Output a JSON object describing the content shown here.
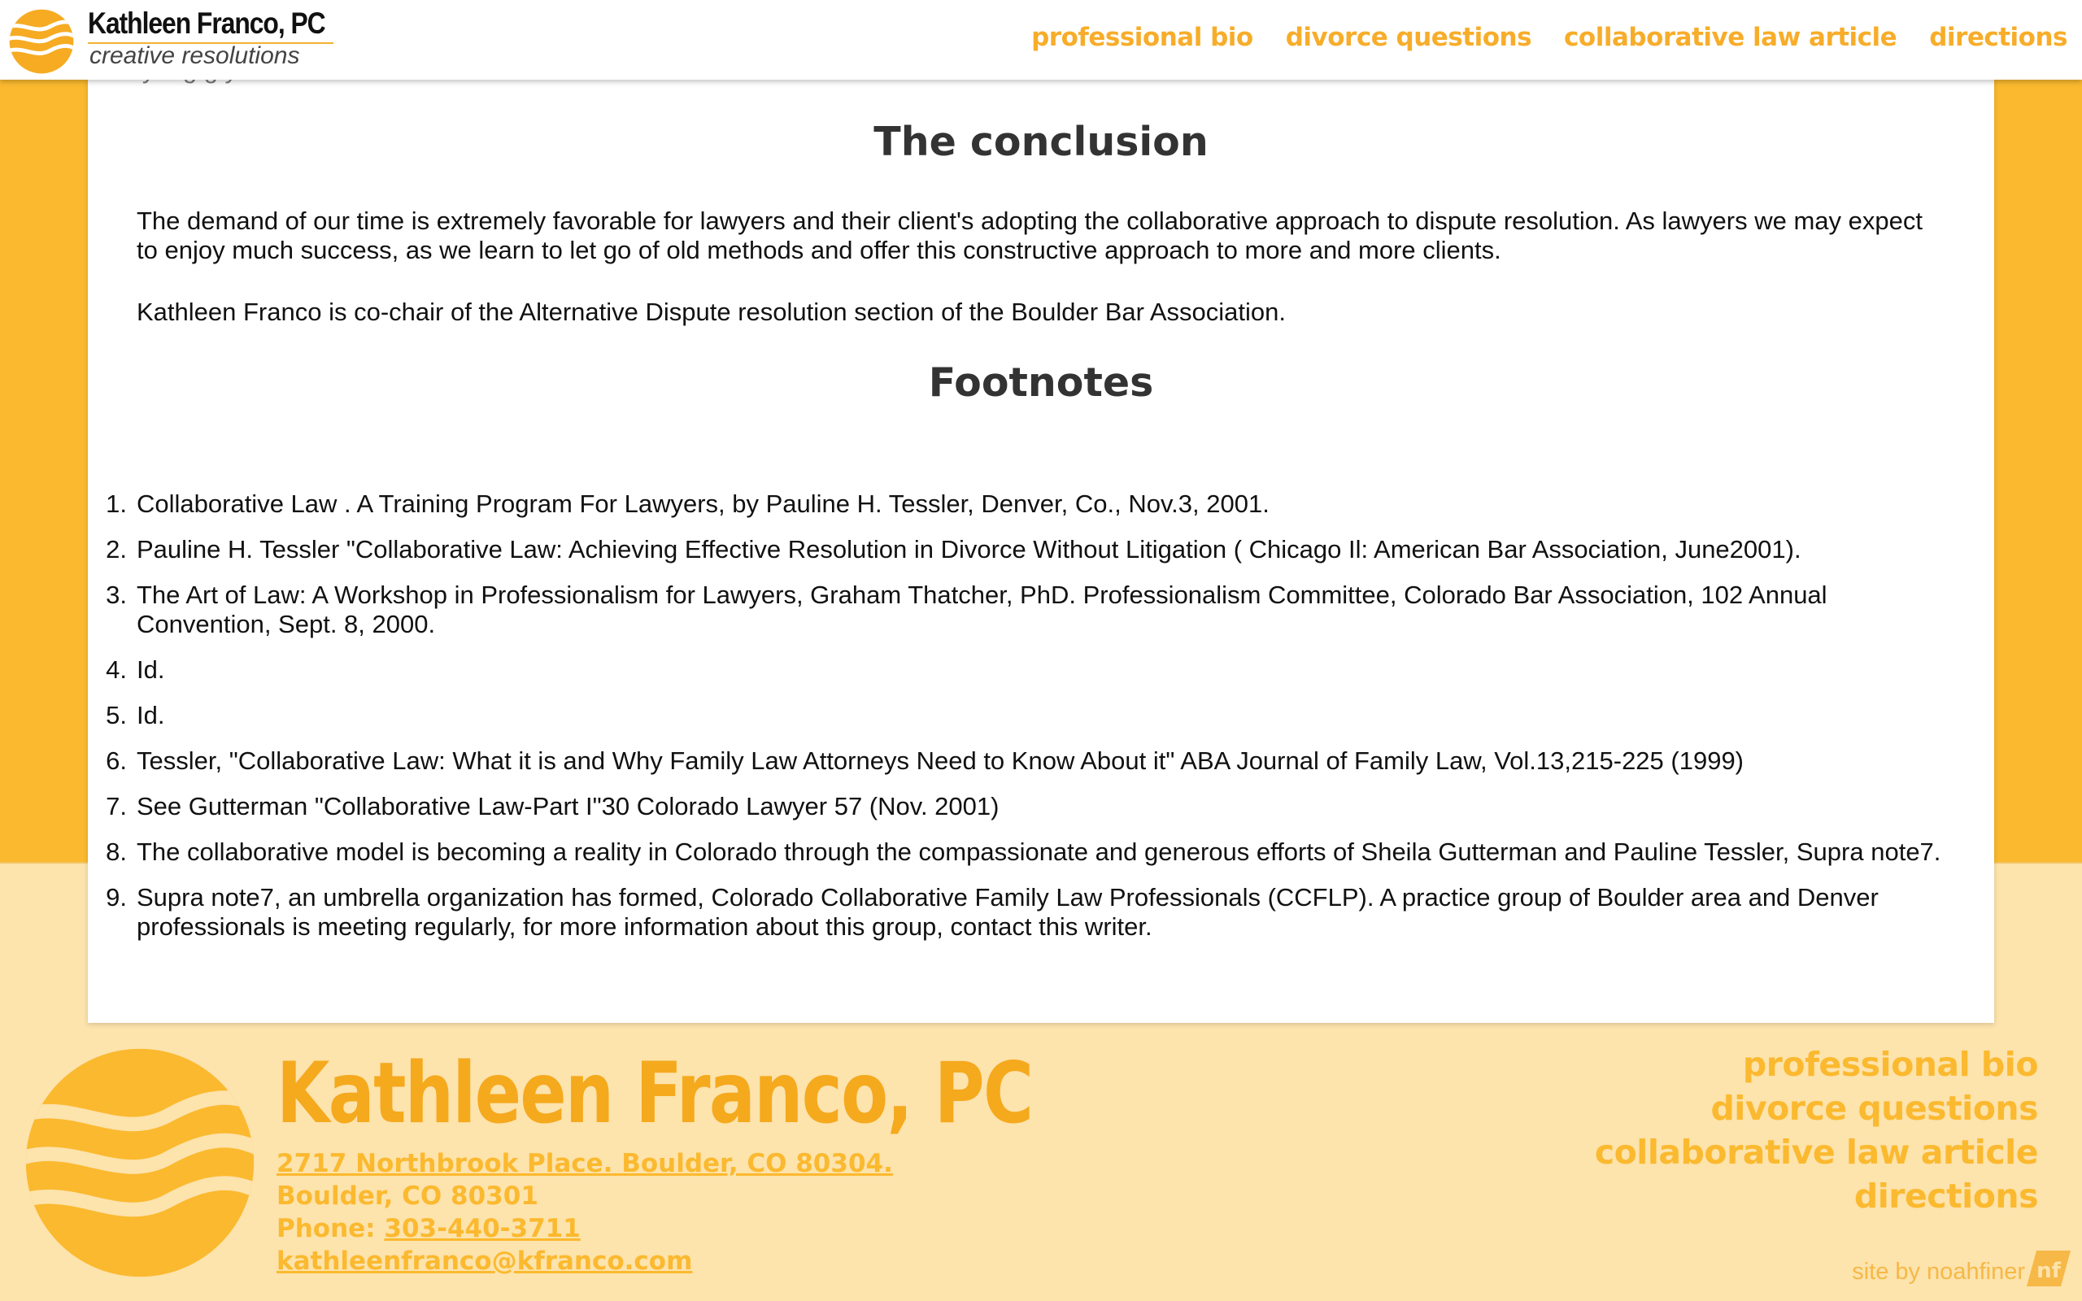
{
  "colors": {
    "accent": "#fbb92f",
    "accent_light": "#fde3ac",
    "heading": "#333333"
  },
  "header": {
    "brand_title": "Kathleen Franco, PC",
    "brand_tagline": "creative resolutions",
    "logo_icon": "wave-circle-logo-icon",
    "nav": [
      "professional bio",
      "divorce questions",
      "collaborative law article",
      "directions"
    ]
  },
  "article": {
    "cut_line": "ly tog          g                       y",
    "conclusion_heading": "The conclusion",
    "conclusion_paragraphs": [
      "The demand of our time is extremely favorable for lawyers and their client's adopting the collaborative approach to dispute resolution. As lawyers we may expect to enjoy much success, as we learn to let go of old methods and offer this constructive approach to more and more clients.",
      "Kathleen Franco is co-chair of the Alternative Dispute resolution section of the Boulder Bar Association."
    ],
    "footnotes_heading": "Footnotes",
    "footnotes": [
      {
        "num": "1.",
        "text": "Collaborative Law . A Training Program For Lawyers, by Pauline H. Tessler, Denver, Co., Nov.3, 2001."
      },
      {
        "num": "2.",
        "text": "Pauline H. Tessler \"Collaborative Law: Achieving Effective Resolution in Divorce Without Litigation ( Chicago Il: American Bar Association, June2001)."
      },
      {
        "num": "3.",
        "text": "The Art of Law: A Workshop in Professionalism for Lawyers, Graham Thatcher, PhD. Professionalism Committee, Colorado Bar Association, 102 Annual Convention, Sept. 8, 2000."
      },
      {
        "num": "4.",
        "text": "Id."
      },
      {
        "num": "5.",
        "text": "Id."
      },
      {
        "num": "6.",
        "text": "Tessler, \"Collaborative Law: What it is and Why Family Law Attorneys Need to Know About it\" ABA Journal of Family Law, Vol.13,215-225 (1999)"
      },
      {
        "num": "7.",
        "text": "See Gutterman \"Collaborative Law-Part I\"30 Colorado Lawyer 57 (Nov. 2001)"
      },
      {
        "num": "8.",
        "text": "The collaborative model is becoming a reality in Colorado through the compassionate and generous efforts of Sheila Gutterman and Pauline Tessler, Supra note7."
      },
      {
        "num": "9.",
        "text": "Supra note7, an umbrella organization has formed, Colorado Collaborative Family Law Professionals (CCFLP). A practice group of Boulder area and Denver professionals is meeting regularly, for more information about this group, contact this writer."
      }
    ]
  },
  "footer": {
    "name": "Kathleen Franco, PC",
    "address_line1": "2717 Northbrook Place. Boulder, CO 80304.",
    "address_line2": "Boulder, CO 80301",
    "phone_label": "Phone: ",
    "phone": "303-440-3711",
    "email": "kathleenfranco@kfranco.com",
    "nav": [
      "professional bio",
      "divorce questions",
      "collaborative law article",
      "directions"
    ],
    "credit": "site by noahfiner",
    "credit_badge_text": "nf",
    "credit_badge_icon": "nf-badge-icon"
  }
}
